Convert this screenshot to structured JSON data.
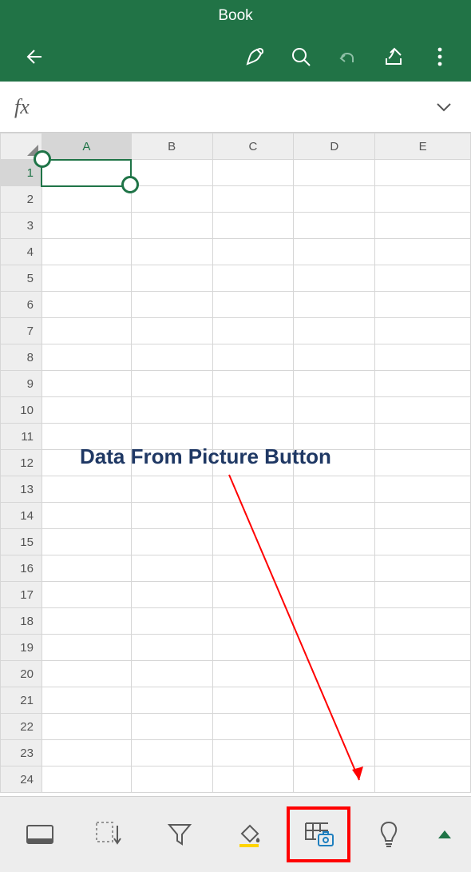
{
  "titlebar": {
    "title": "Book"
  },
  "toolbar": {
    "back": "back",
    "draw": "draw",
    "search": "search",
    "undo": "undo",
    "share": "share",
    "more": "more"
  },
  "formula_bar": {
    "fx": "fx",
    "value": ""
  },
  "grid": {
    "columns": [
      "A",
      "B",
      "C",
      "D",
      "E"
    ],
    "rows": [
      "1",
      "2",
      "3",
      "4",
      "5",
      "6",
      "7",
      "8",
      "9",
      "10",
      "11",
      "12",
      "13",
      "14",
      "15",
      "16",
      "17",
      "18",
      "19",
      "20",
      "21",
      "22",
      "23",
      "24"
    ],
    "selected_cell": "A1"
  },
  "annotation": {
    "text": "Data From Picture Button"
  },
  "bottombar": {
    "card_view": "card-view",
    "sort": "sort",
    "filter": "filter",
    "fill_color": "fill-color",
    "data_from_picture": "data-from-picture",
    "ideas": "ideas",
    "expand": "expand"
  }
}
